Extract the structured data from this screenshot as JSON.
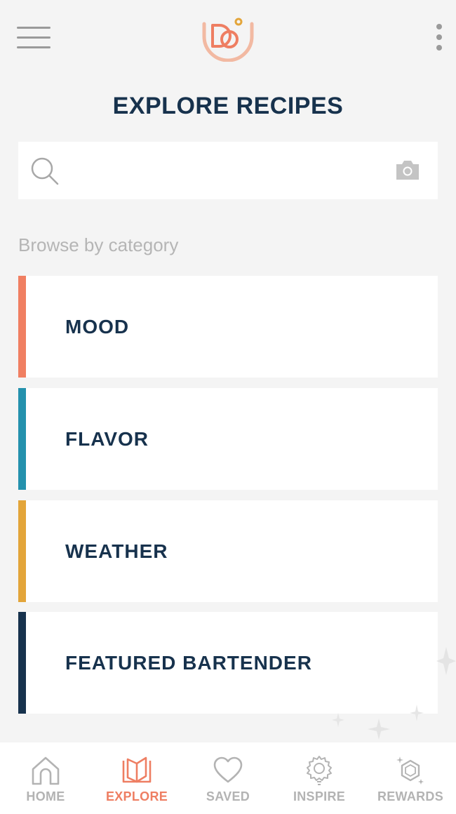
{
  "header": {
    "menu_icon": "hamburger-menu-icon",
    "logo_icon": "brand-logo",
    "more_icon": "more-vertical-icon"
  },
  "page": {
    "title": "EXPLORE RECIPES"
  },
  "search": {
    "value": "",
    "placeholder": "",
    "search_icon": "search-icon",
    "camera_icon": "camera-icon"
  },
  "browse": {
    "label": "Browse by category",
    "categories": [
      {
        "label": "MOOD",
        "color": "#f07f62"
      },
      {
        "label": "FLAVOR",
        "color": "#2491ad"
      },
      {
        "label": "WEATHER",
        "color": "#e3a53a"
      },
      {
        "label": "FEATURED BARTENDER",
        "color": "#17324d"
      }
    ]
  },
  "nav": {
    "active": "EXPLORE",
    "items": [
      {
        "label": "HOME",
        "icon": "home-icon"
      },
      {
        "label": "EXPLORE",
        "icon": "book-icon"
      },
      {
        "label": "SAVED",
        "icon": "heart-icon"
      },
      {
        "label": "INSPIRE",
        "icon": "lightbulb-icon"
      },
      {
        "label": "REWARDS",
        "icon": "gem-icon"
      }
    ]
  },
  "colors": {
    "title": "#17324d",
    "accent": "#ee7e62",
    "inactive": "#b3b3b3",
    "background": "#f4f4f4"
  }
}
